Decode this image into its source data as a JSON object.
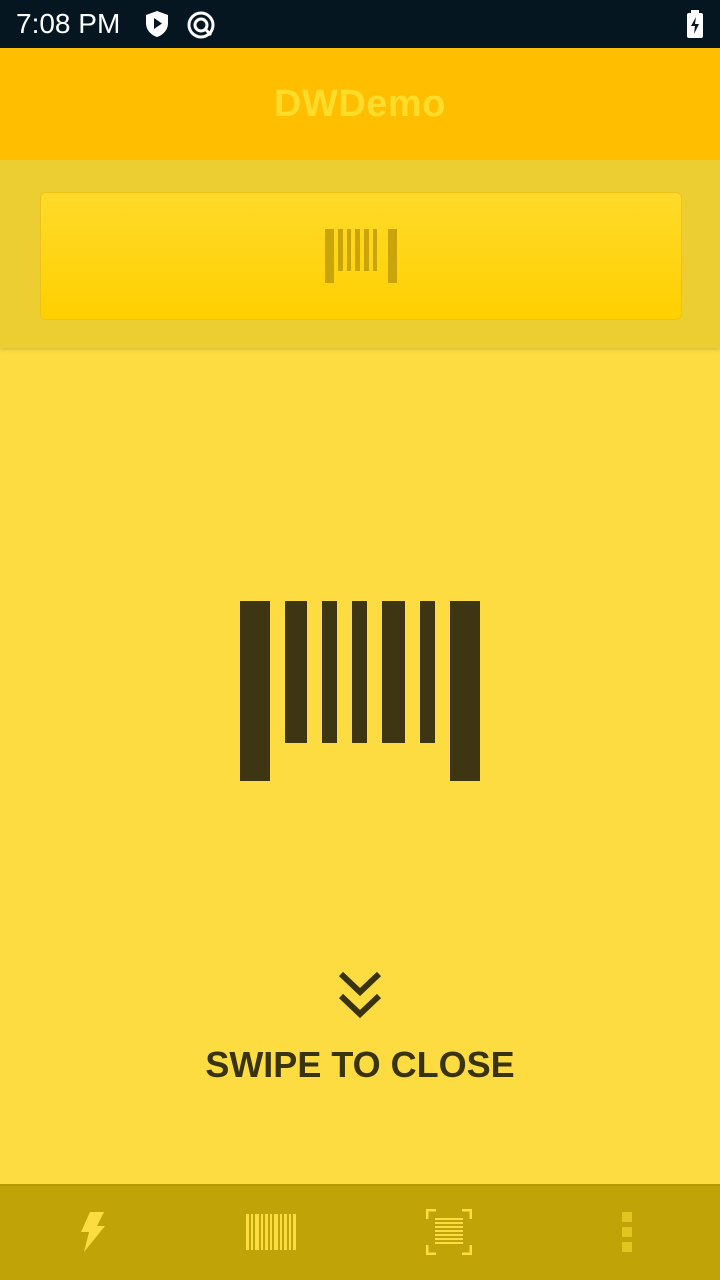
{
  "status_bar": {
    "time": "7:08 PM",
    "icons": [
      "shield-play-icon",
      "sync-icon",
      "battery-charging-icon"
    ]
  },
  "app_bar": {
    "title": "DWDemo"
  },
  "scan_button": {
    "icon": "barcode-icon"
  },
  "scanner_panel": {
    "icon": "barcode-large-icon",
    "swipe_icon": "double-chevron-down-icon",
    "swipe_label": "SWIPE TO CLOSE"
  },
  "bottom_bar": {
    "items": [
      "flash-icon",
      "barcode-icon",
      "scan-frame-icon",
      "more-vert-icon"
    ]
  },
  "colors": {
    "status_bar": "#061621",
    "app_bar": "#FFBF00",
    "panel": "#FCDC40",
    "dark_text": "#3A3310",
    "bottom_bar": "#C0A307"
  }
}
